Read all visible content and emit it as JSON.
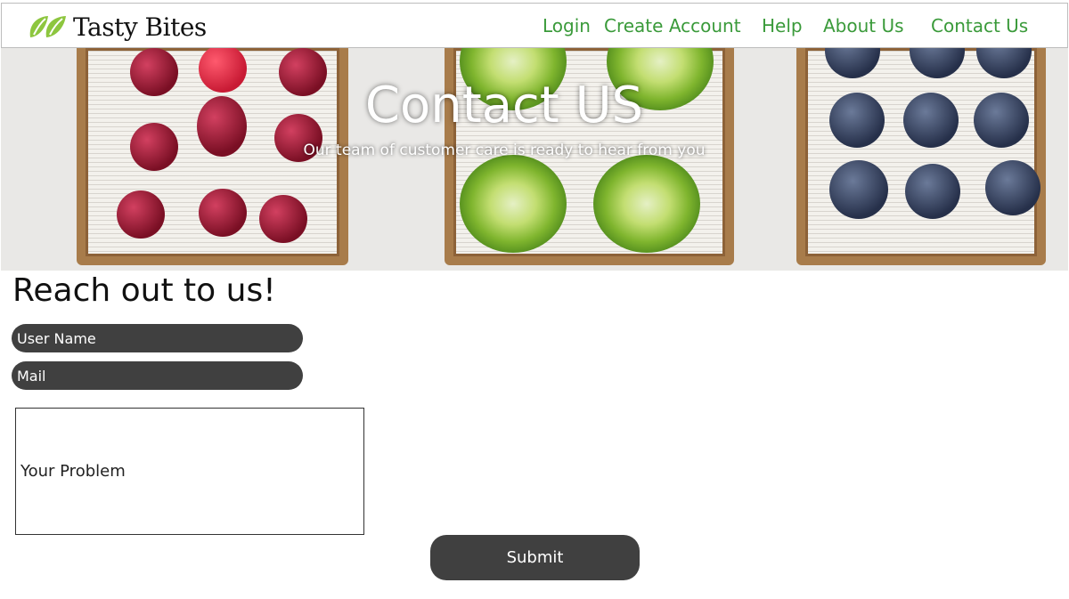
{
  "brand": {
    "name": "Tasty Bites",
    "logo_icon": "leaf-logo-icon",
    "logo_color": "#8dc63f"
  },
  "nav": {
    "items": [
      {
        "label": "Login"
      },
      {
        "label": "Create Account"
      },
      {
        "label": "Help"
      },
      {
        "label": "About Us"
      },
      {
        "label": "Contact Us"
      }
    ],
    "link_color": "#3a9a3a"
  },
  "hero": {
    "title": "Contact US",
    "subtitle": "Our team of customer care is ready to hear from you"
  },
  "form": {
    "heading": "Reach out to us!",
    "username_placeholder": "User Name",
    "mail_placeholder": "Mail",
    "problem_placeholder": "Your Problem",
    "submit_label": "Submit",
    "control_color": "#404040"
  }
}
